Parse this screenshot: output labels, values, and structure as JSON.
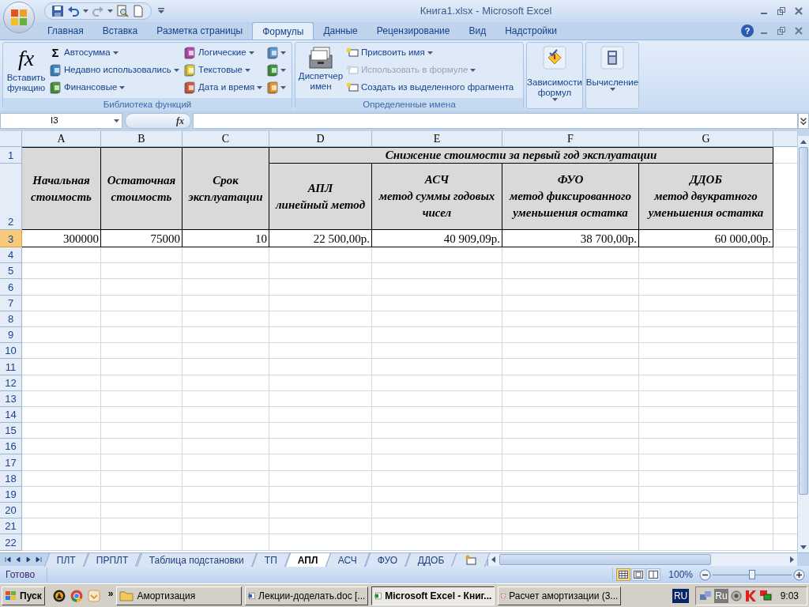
{
  "window": {
    "title": "Книга1.xlsx - Microsoft Excel",
    "help_symbol": "?"
  },
  "ribbon_tabs": [
    {
      "label": "Главная",
      "selected": false
    },
    {
      "label": "Вставка",
      "selected": false
    },
    {
      "label": "Разметка страницы",
      "selected": false
    },
    {
      "label": "Формулы",
      "selected": true
    },
    {
      "label": "Данные",
      "selected": false
    },
    {
      "label": "Рецензирование",
      "selected": false
    },
    {
      "label": "Вид",
      "selected": false
    },
    {
      "label": "Надстройки",
      "selected": false
    }
  ],
  "function_library": {
    "title": "Библиотека функций",
    "insert_symbol": "fx",
    "insert_label": "Вставить\nфункцию",
    "items": [
      {
        "label": "Автосумма",
        "symbol": "Σ"
      },
      {
        "label": "Недавно использовались"
      },
      {
        "label": "Финансовые"
      },
      {
        "label": "Логические"
      },
      {
        "label": "Текстовые"
      },
      {
        "label": "Дата и время"
      }
    ]
  },
  "defined_names": {
    "title": "Определенные имена",
    "manager_label": "Диспетчер\nимен",
    "items": [
      {
        "label": "Присвоить имя",
        "dropdown": true,
        "disabled": false
      },
      {
        "label": "Использовать в формуле",
        "dropdown": true,
        "disabled": true
      },
      {
        "label": "Создать из выделенного фрагмента",
        "dropdown": false,
        "disabled": false
      }
    ]
  },
  "big_buttons": [
    {
      "label": "Зависимости\nформул"
    },
    {
      "label": "Вычисление"
    }
  ],
  "formula_bar": {
    "name_box": "I3",
    "fx": "fx"
  },
  "sheet": {
    "columns": [
      {
        "label": "A",
        "selected": false
      },
      {
        "label": "B",
        "selected": false
      },
      {
        "label": "C",
        "selected": false
      },
      {
        "label": "D",
        "selected": false
      },
      {
        "label": "E",
        "selected": false
      },
      {
        "label": "F",
        "selected": false
      },
      {
        "label": "G",
        "selected": false
      }
    ],
    "rows": [
      {
        "label": "1",
        "selected": false
      },
      {
        "label": "2",
        "selected": false
      },
      {
        "label": "3",
        "selected": true
      },
      {
        "label": "4",
        "selected": false
      },
      {
        "label": "5",
        "selected": false
      },
      {
        "label": "6",
        "selected": false
      },
      {
        "label": "7",
        "selected": false
      },
      {
        "label": "8",
        "selected": false
      },
      {
        "label": "9",
        "selected": false
      },
      {
        "label": "10",
        "selected": false
      },
      {
        "label": "11",
        "selected": false
      },
      {
        "label": "12",
        "selected": false
      },
      {
        "label": "13",
        "selected": false
      },
      {
        "label": "14",
        "selected": false
      },
      {
        "label": "15",
        "selected": false
      },
      {
        "label": "16",
        "selected": false
      },
      {
        "label": "17",
        "selected": false
      },
      {
        "label": "18",
        "selected": false
      },
      {
        "label": "19",
        "selected": false
      },
      {
        "label": "20",
        "selected": false
      },
      {
        "label": "21",
        "selected": false
      },
      {
        "label": "22",
        "selected": false
      }
    ],
    "group_title": "Снижение стоимости за первый год эксплуатации",
    "headers": [
      "Начальная\nстоимость",
      "Остаточная\nстоимость",
      "Срок\nэксплуатации",
      "АПЛ\nлинейный метод",
      "АСЧ\nметод суммы годовых\nчисел",
      "ФУО\nметод фиксированного\nуменьшения остатка",
      "ДДОБ\nметод двукратного\nуменьшения остатка"
    ],
    "values": [
      "300000",
      "75000",
      "10",
      "22 500,00р.",
      "40 909,09р.",
      "38 700,00р.",
      "60 000,00р."
    ]
  },
  "sheet_tabs": [
    {
      "label": "ПЛТ",
      "selected": false
    },
    {
      "label": "ПРПЛТ",
      "selected": false
    },
    {
      "label": "Таблица подстановки",
      "selected": false
    },
    {
      "label": "ТП",
      "selected": false
    },
    {
      "label": "АПЛ",
      "selected": true
    },
    {
      "label": "АСЧ",
      "selected": false
    },
    {
      "label": "ФУО",
      "selected": false
    },
    {
      "label": "ДДОБ",
      "selected": false
    }
  ],
  "status_bar": {
    "status": "Готово",
    "views": [
      {
        "selected": true
      },
      {
        "selected": false
      },
      {
        "selected": false
      }
    ],
    "zoom": {
      "reading": "100%",
      "level": 0.5
    }
  },
  "taskbar": {
    "start": "Пуск",
    "more": "»",
    "tasks": [
      {
        "label": "Амортизация",
        "selected": false
      },
      {
        "label": "Лекции-доделать.doc [...",
        "selected": false
      },
      {
        "label": "Microsoft Excel - Книг...",
        "selected": true
      },
      {
        "label": "Расчет амортизации  (3...",
        "selected": false
      }
    ],
    "language": "RU",
    "tray_language": "Ru",
    "time": "9:03"
  }
}
